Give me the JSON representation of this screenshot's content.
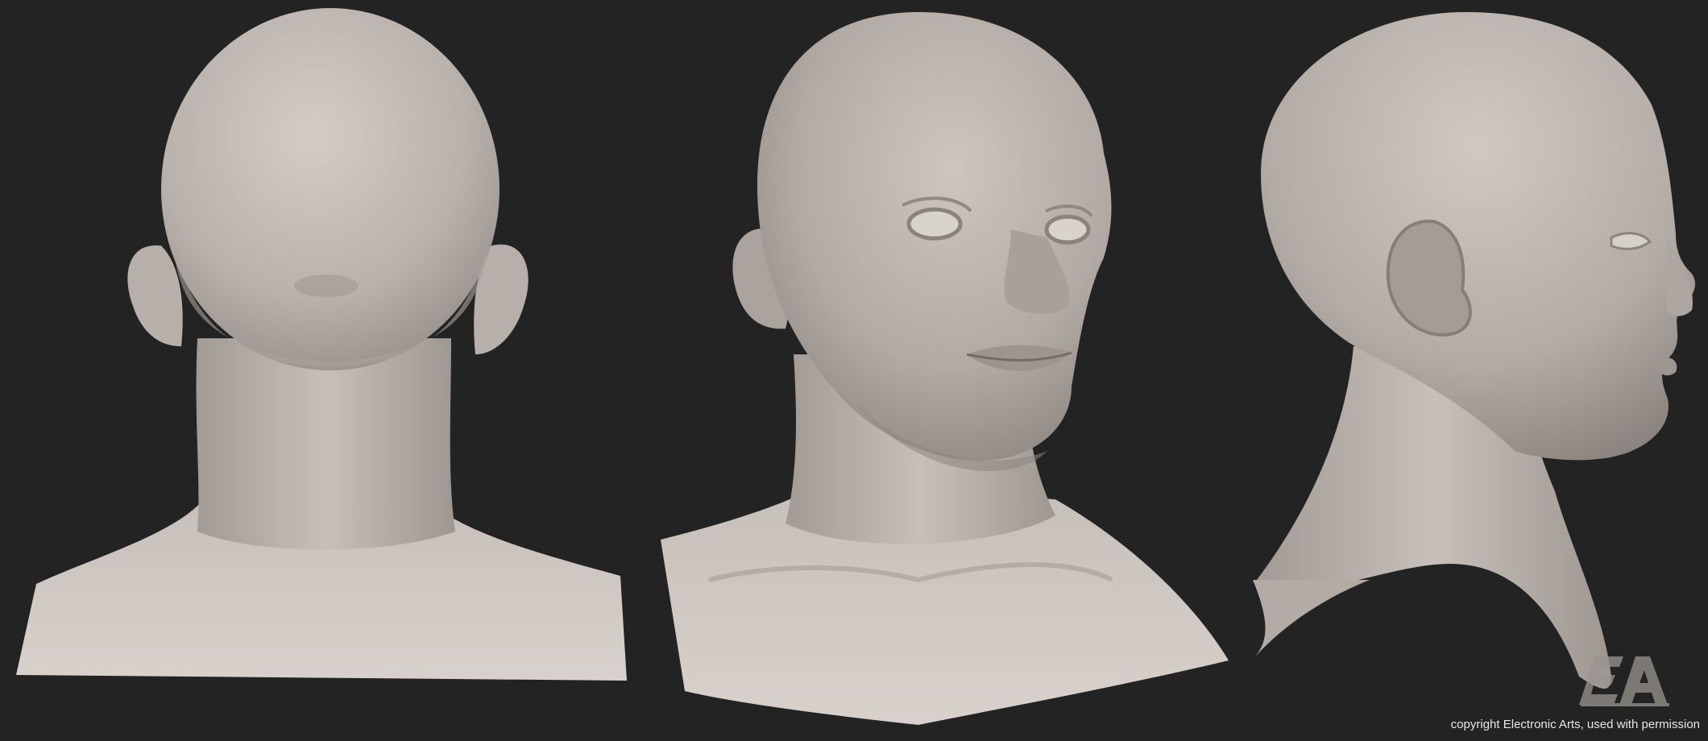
{
  "image": {
    "background_color": "#232323",
    "skin_color": "#c9c2bc",
    "views": [
      {
        "label": "",
        "icon": "head-back-view"
      },
      {
        "label": "",
        "icon": "head-three-quarter-view"
      },
      {
        "label": "",
        "icon": "head-side-view"
      }
    ]
  },
  "branding": {
    "logo_text": "EA",
    "copyright": "copyright Electronic Arts, used with permission"
  }
}
